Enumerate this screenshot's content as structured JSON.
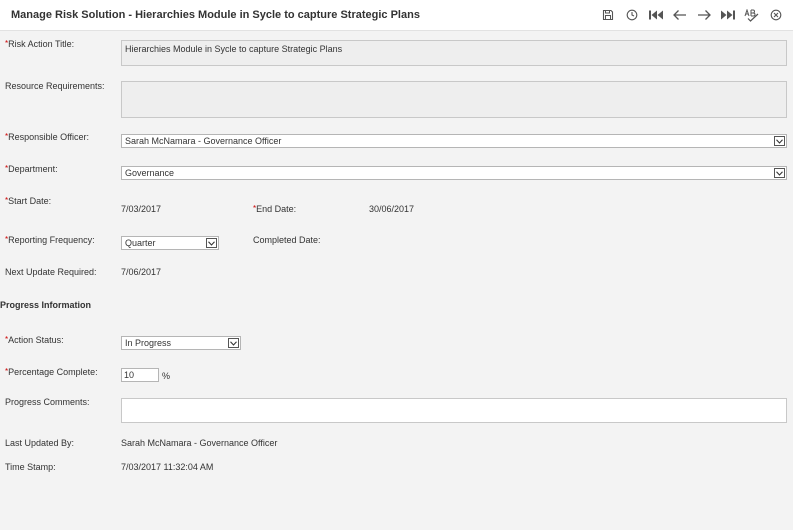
{
  "header": {
    "title": "Manage Risk Solution - Hierarchies Module in Sycle to capture Strategic Plans"
  },
  "toolbar": {
    "icons": [
      "save-icon",
      "history-icon",
      "first-record-icon",
      "previous-record-icon",
      "next-record-icon",
      "last-record-icon",
      "spellcheck-icon",
      "close-icon"
    ]
  },
  "form": {
    "risk_action_title": {
      "label": "Risk Action Title:",
      "value": "Hierarchies Module in Sycle to capture Strategic Plans"
    },
    "resource_requirements": {
      "label": "Resource Requirements:",
      "value": ""
    },
    "responsible_officer": {
      "label": "Responsible Officer:",
      "value": "Sarah McNamara - Governance Officer"
    },
    "department": {
      "label": "Department:",
      "value": "Governance"
    },
    "start_date": {
      "label": "Start Date:",
      "value": "7/03/2017"
    },
    "end_date": {
      "label": "End Date:",
      "value": "30/06/2017"
    },
    "reporting_frequency": {
      "label": "Reporting Frequency:",
      "value": "Quarter"
    },
    "completed_date": {
      "label": "Completed Date:",
      "value": ""
    },
    "next_update_required": {
      "label": "Next Update Required:",
      "value": "7/06/2017"
    }
  },
  "progress": {
    "section_title": "Progress Information",
    "action_status": {
      "label": "Action Status:",
      "value": "In Progress"
    },
    "percentage_complete": {
      "label": "Percentage Complete:",
      "value": "10",
      "unit": "%"
    },
    "progress_comments": {
      "label": "Progress Comments:",
      "value": ""
    },
    "last_updated_by": {
      "label": "Last Updated By:",
      "value": "Sarah McNamara - Governance Officer"
    },
    "time_stamp": {
      "label": "Time Stamp:",
      "value": "7/03/2017 11:32:04 AM"
    }
  },
  "required_marker": "*",
  "colors": {
    "required": "#cc0000",
    "background": "#f3f3f3",
    "icon": "#555555"
  }
}
